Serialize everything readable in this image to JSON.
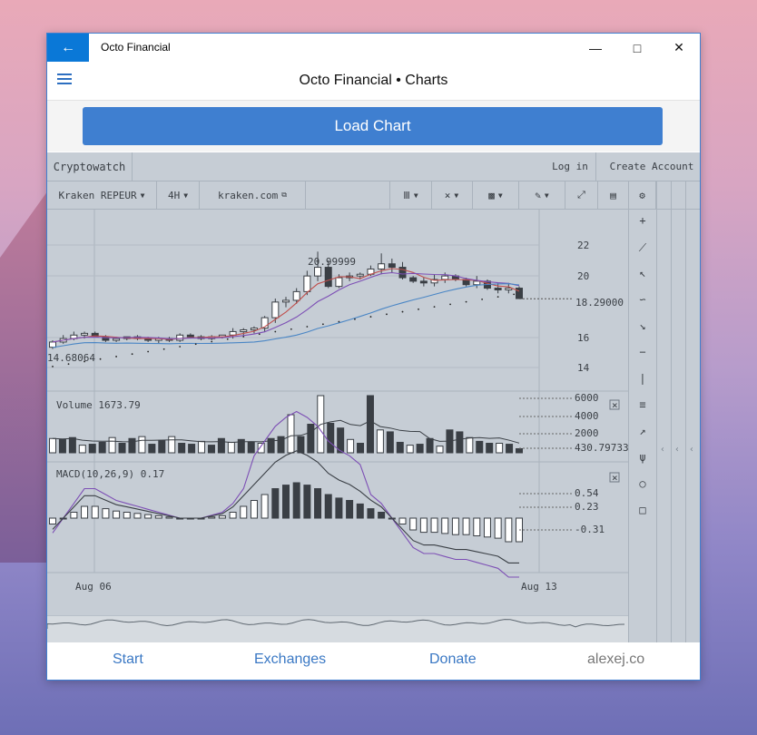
{
  "window": {
    "title": "Octo Financial",
    "back_icon": "arrow-left-icon",
    "accent": "#0a78d7"
  },
  "header": {
    "title": "Octo Financial • Charts",
    "menu_icon": "hamburger-icon"
  },
  "load_button": {
    "label": "Load Chart",
    "color": "#3f7fd0"
  },
  "cryptowatch": {
    "brand": "Cryptowatch",
    "login": "Log in",
    "create_account": "Create Account",
    "market": "Kraken REPEUR",
    "interval": "4H",
    "exchange_link": "kraken.com"
  },
  "price_pane": {
    "ticks": [
      "22",
      "20",
      "18.29000",
      "16",
      "14"
    ],
    "high_label": "20.99999",
    "low_label": "14.68064"
  },
  "volume_pane": {
    "label": "Volume  1673.79",
    "ticks": [
      "6000",
      "4000",
      "2000",
      "430.79733"
    ]
  },
  "macd_pane": {
    "label": "MACD(10,26,9) 0.17",
    "ticks": [
      "0.54",
      "0.23",
      "-0.31"
    ]
  },
  "x_axis": {
    "labels": [
      "Aug 06",
      "Aug 13"
    ]
  },
  "chart_data": {
    "type": "candlestick",
    "candles": [
      [
        15.5,
        15.9,
        15.4,
        15.8
      ],
      [
        15.8,
        16.2,
        15.7,
        16.0
      ],
      [
        16.0,
        16.4,
        15.9,
        16.2
      ],
      [
        16.2,
        16.4,
        16.0,
        16.3
      ],
      [
        16.3,
        16.4,
        16.1,
        16.1
      ],
      [
        16.1,
        16.2,
        15.8,
        15.9
      ],
      [
        15.9,
        16.1,
        15.8,
        16.0
      ],
      [
        16.0,
        16.1,
        15.9,
        16.1
      ],
      [
        16.1,
        16.2,
        15.9,
        16.0
      ],
      [
        16.0,
        16.1,
        15.8,
        15.9
      ],
      [
        15.9,
        16.1,
        15.7,
        16.0
      ],
      [
        16.0,
        16.1,
        15.8,
        15.9
      ],
      [
        15.9,
        16.3,
        15.8,
        16.2
      ],
      [
        16.2,
        16.3,
        16.0,
        16.1
      ],
      [
        16.1,
        16.2,
        15.9,
        16.0
      ],
      [
        16.0,
        16.2,
        15.9,
        16.1
      ],
      [
        16.1,
        16.2,
        16.0,
        16.2
      ],
      [
        16.2,
        16.6,
        16.0,
        16.4
      ],
      [
        16.4,
        16.6,
        16.2,
        16.5
      ],
      [
        16.5,
        16.7,
        16.3,
        16.6
      ],
      [
        16.6,
        17.3,
        16.4,
        17.2
      ],
      [
        17.2,
        18.3,
        16.9,
        18.1
      ],
      [
        18.1,
        18.4,
        17.8,
        18.2
      ],
      [
        18.2,
        18.9,
        18.0,
        18.7
      ],
      [
        18.7,
        19.9,
        18.5,
        19.6
      ],
      [
        19.6,
        21.0,
        19.3,
        20.1
      ],
      [
        20.1,
        20.5,
        18.9,
        19.0
      ],
      [
        19.0,
        19.7,
        18.9,
        19.5
      ],
      [
        19.5,
        19.8,
        19.3,
        19.6
      ],
      [
        19.6,
        19.8,
        19.4,
        19.7
      ],
      [
        19.7,
        20.2,
        19.6,
        20.0
      ],
      [
        20.0,
        20.9,
        19.7,
        20.3
      ],
      [
        20.3,
        20.6,
        19.8,
        20.1
      ],
      [
        20.1,
        20.4,
        19.4,
        19.5
      ],
      [
        19.5,
        19.6,
        19.2,
        19.3
      ],
      [
        19.3,
        19.5,
        19.0,
        19.2
      ],
      [
        19.2,
        19.7,
        19.0,
        19.4
      ],
      [
        19.4,
        19.8,
        19.2,
        19.6
      ],
      [
        19.6,
        19.7,
        19.3,
        19.4
      ],
      [
        19.4,
        19.5,
        19.0,
        19.1
      ],
      [
        19.1,
        19.6,
        18.9,
        19.3
      ],
      [
        19.3,
        19.4,
        18.8,
        18.9
      ],
      [
        18.9,
        19.2,
        18.6,
        18.8
      ],
      [
        18.8,
        19.2,
        18.6,
        18.9
      ],
      [
        18.9,
        19.0,
        18.3,
        18.3
      ]
    ],
    "volume": [
      1500,
      1400,
      1600,
      800,
      900,
      1100,
      1600,
      1000,
      1500,
      1700,
      900,
      1300,
      1700,
      1000,
      900,
      1200,
      800,
      1500,
      1100,
      1400,
      1100,
      1000,
      1500,
      1700,
      4000,
      1700,
      3000,
      6000,
      3100,
      2600,
      1400,
      1000,
      6000,
      2400,
      2200,
      1100,
      800,
      900,
      1500,
      700,
      2400,
      2200,
      1600,
      1200,
      1000,
      1000,
      900,
      430
    ],
    "macd": [
      -0.05,
      0.0,
      0.05,
      0.1,
      0.1,
      0.08,
      0.06,
      0.05,
      0.04,
      0.03,
      0.02,
      0.01,
      0.0,
      0.0,
      0.0,
      0.01,
      0.02,
      0.05,
      0.1,
      0.15,
      0.2,
      0.25,
      0.28,
      0.3,
      0.28,
      0.25,
      0.2,
      0.17,
      0.15,
      0.12,
      0.08,
      0.05,
      0.0,
      -0.05,
      -0.1,
      -0.12,
      -0.12,
      -0.13,
      -0.14,
      -0.14,
      -0.15,
      -0.16,
      -0.17,
      -0.2,
      -0.2
    ],
    "ylim": [
      13.5,
      23
    ],
    "colors": {
      "up": "#ffffff",
      "down": "#3a3f45",
      "ma_red": "#c0504d",
      "ma_purple": "#7d4fb5",
      "ma_blue": "#4a86c5"
    }
  },
  "bottom_nav": {
    "items": [
      "Start",
      "Exchanges",
      "Donate"
    ],
    "site": "alexej.co"
  }
}
